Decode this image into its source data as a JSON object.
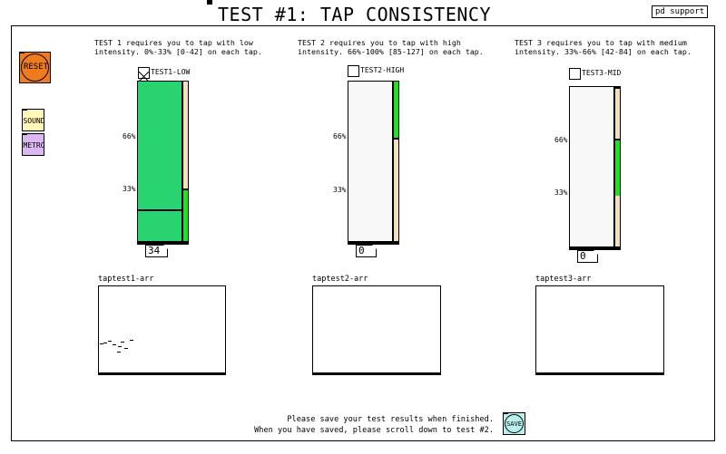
{
  "title": "TEST #1: TAP CONSISTENCY",
  "pd_support": "pd support",
  "buttons": {
    "reset": "RESET",
    "sound": "SOUND",
    "metro": "METRO",
    "save": "SAVE"
  },
  "colors": {
    "reset": "#f07b1e",
    "sound": "#fff6b8",
    "metro": "#dcb8f2",
    "save": "#b8f0ec",
    "meter_fill": "#29d470",
    "zone": "#22e022",
    "strip": "#f4dfc0"
  },
  "tests": [
    {
      "desc_line1": "TEST 1 requires you to tap with low",
      "desc_line2": "intensity. 0%-33% [0-42] on each tap.",
      "toggle_label": "TEST1-LOW",
      "checked": true,
      "pct_66": "66%",
      "pct_33": "33%",
      "value": "34",
      "array_label": "taptest1-arr"
    },
    {
      "desc_line1": "TEST 2 requires you to tap with high",
      "desc_line2": "intensity. 66%-100% [85-127] on each tap.",
      "toggle_label": "TEST2-HIGH",
      "checked": false,
      "pct_66": "66%",
      "pct_33": "33%",
      "value": "0",
      "array_label": "taptest2-arr"
    },
    {
      "desc_line1": "TEST 3 requires you to tap with medium",
      "desc_line2": "intensity. 33%-66% [42-84] on each tap.",
      "toggle_label": "TEST3-MID",
      "checked": false,
      "pct_66": "66%",
      "pct_33": "33%",
      "value": "0",
      "array_label": "taptest3-arr"
    }
  ],
  "footer": {
    "line1": "Please save your test results when finished.",
    "line2": "When you have saved, please scroll down to test #2."
  }
}
